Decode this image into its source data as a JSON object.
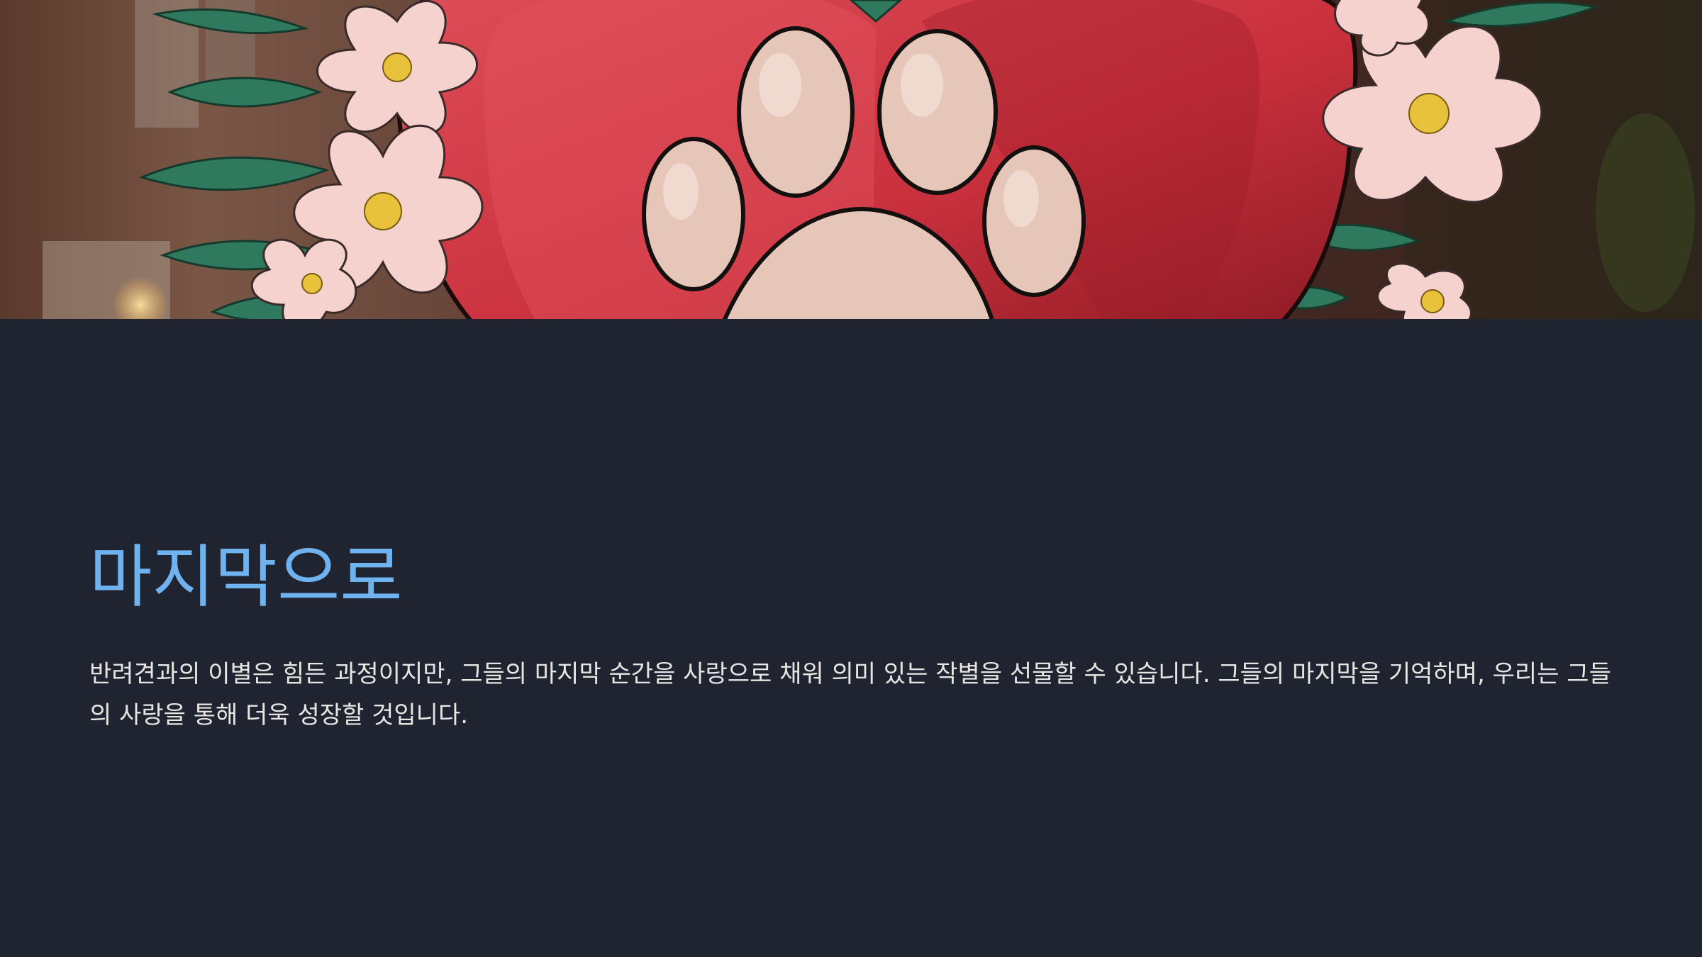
{
  "slide": {
    "title": "마지막으로",
    "body": "반려견과의 이별은 힘든 과정이지만, 그들의 마지막 순간을 사랑으로 채워 의미 있는 작별을 선물할 수 있습니다. 그들의 마지막을 기억하며, 우리는 그들의 사랑을 통해 더욱 성장할 것입니다."
  },
  "colors": {
    "background": "#1f2430",
    "title": "#6fb2f0",
    "body_text": "#e8e6e3",
    "heart_red": "#c8303c",
    "paw_pad": "#e6c6b8",
    "blossom_pink": "#f6d2ce",
    "leaf_green": "#2f7a5e"
  },
  "hero_image": {
    "icon": "heart-paw-blossom-illustration"
  }
}
